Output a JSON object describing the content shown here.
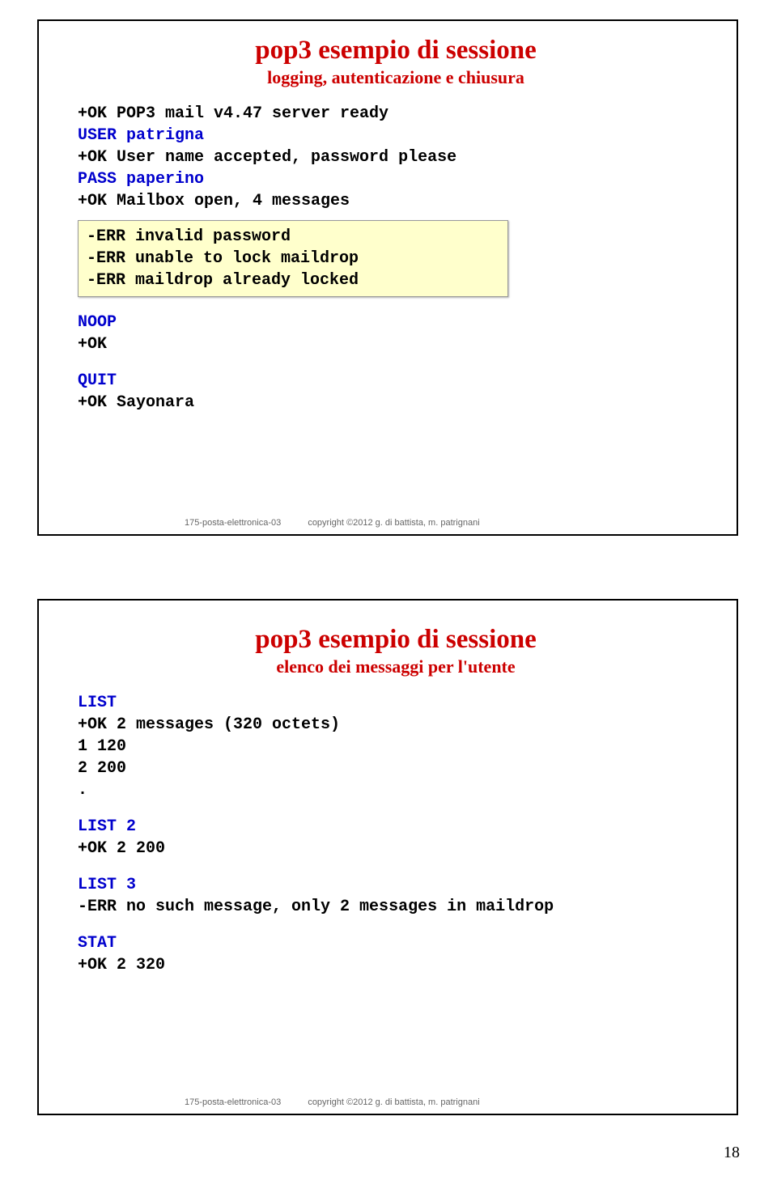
{
  "slide1": {
    "title": "pop3 esempio di sessione",
    "subtitle": "logging, autenticazione e chiusura",
    "line1": "+OK POP3 mail v4.47 server ready",
    "cmd1": "USER patrigna",
    "resp1": "+OK User name accepted, password please",
    "cmd2": "PASS paperino",
    "resp2": "+OK Mailbox open, 4 messages",
    "err1": "-ERR invalid password",
    "err2": "-ERR unable to lock maildrop",
    "err3": "-ERR maildrop already locked",
    "cmd3": "NOOP",
    "resp3": "+OK",
    "cmd4": "QUIT",
    "resp4": "+OK Sayonara",
    "footer_left": "175-posta-elettronica-03",
    "footer_right": "copyright ©2012 g. di battista, m. patrignani"
  },
  "slide2": {
    "title": "pop3 esempio di sessione",
    "subtitle": "elenco dei messaggi per l'utente",
    "cmd1": "LIST",
    "resp1": "+OK 2 messages (320 octets)",
    "resp1b": "1 120",
    "resp1c": "2 200",
    "resp1d": ".",
    "cmd2": "LIST 2",
    "resp2": "+OK 2 200",
    "cmd3": "LIST 3",
    "resp3": "-ERR no such message, only 2 messages in maildrop",
    "cmd4": "STAT",
    "resp4": "+OK 2 320",
    "footer_left": "175-posta-elettronica-03",
    "footer_right": "copyright ©2012 g. di battista, m. patrignani"
  },
  "page_number": "18"
}
